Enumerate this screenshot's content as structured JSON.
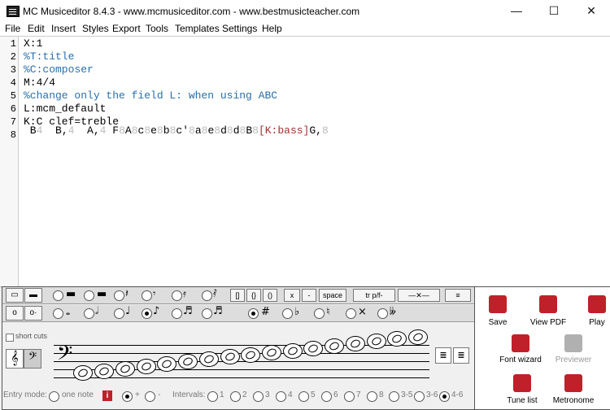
{
  "window": {
    "title": "MC Musiceditor 8.4.3 - www.mcmusiceditor.com - www.bestmusicteacher.com"
  },
  "menu": [
    "File",
    "Edit",
    "Insert",
    "Styles",
    "Export",
    "Tools",
    "Templates",
    "Settings",
    "Help"
  ],
  "editor": {
    "line_numbers": [
      "1",
      "2",
      "3",
      "4",
      "5",
      "6",
      "7",
      "8"
    ],
    "lines": [
      "X:1",
      "%T:title",
      "%C:composer",
      "M:4/4",
      "%change only the field L: when using ABC",
      "L:mcm_default",
      "K:C clef=treble"
    ],
    "line8": {
      "a": " B",
      "a_dur": "4",
      "b": "  B,",
      "b_dur": "4",
      "c": "  A,",
      "c_dur": "4",
      "d": " F",
      "d_dur": "8",
      "e": "A",
      "e_dur": "8",
      "f": "c",
      "f_dur": "8",
      "g": "e",
      "g_dur": "8",
      "h": "b",
      "h_dur": "8",
      "i": "c'",
      "i_dur": "8",
      "j": "a",
      "j_dur": "8",
      "k": "e",
      "k_dur": "8",
      "l": "d",
      "l_dur": "8",
      "m": "d",
      "m_dur": "8",
      "n": "B",
      "n_dur": "8",
      "kbass": "[K:bass]",
      "o": "G,",
      "o_dur": "8"
    }
  },
  "toolbar": {
    "brackets": [
      "[]",
      "{}",
      "()"
    ],
    "x_label": "x",
    "dash_label": "-",
    "space_label": "space",
    "ornaments_label": "tr p/f-",
    "sharp_label": "#",
    "short_cuts_label": "short cuts"
  },
  "entry": {
    "mode_label": "Entry mode:",
    "one_note_label": "one note",
    "info_icon_label": "i",
    "plus_label": "+",
    "minus_label": "-",
    "intervals_label": "Intervals:",
    "intervals": [
      "1",
      "2",
      "3",
      "4",
      "5",
      "6",
      "7",
      "8",
      "3-5",
      "3-6",
      "4-6"
    ]
  },
  "actions": {
    "save": "Save",
    "view_pdf": "View PDF",
    "play": "Play",
    "font_wizard": "Font wizard",
    "previewer": "Previewer",
    "tune_list": "Tune list",
    "metronome": "Metronome"
  },
  "colors": {
    "accent": "#c0202a",
    "comment": "#2a6fa8",
    "dim": "#bbbbbb",
    "bracket": "#a03030"
  }
}
